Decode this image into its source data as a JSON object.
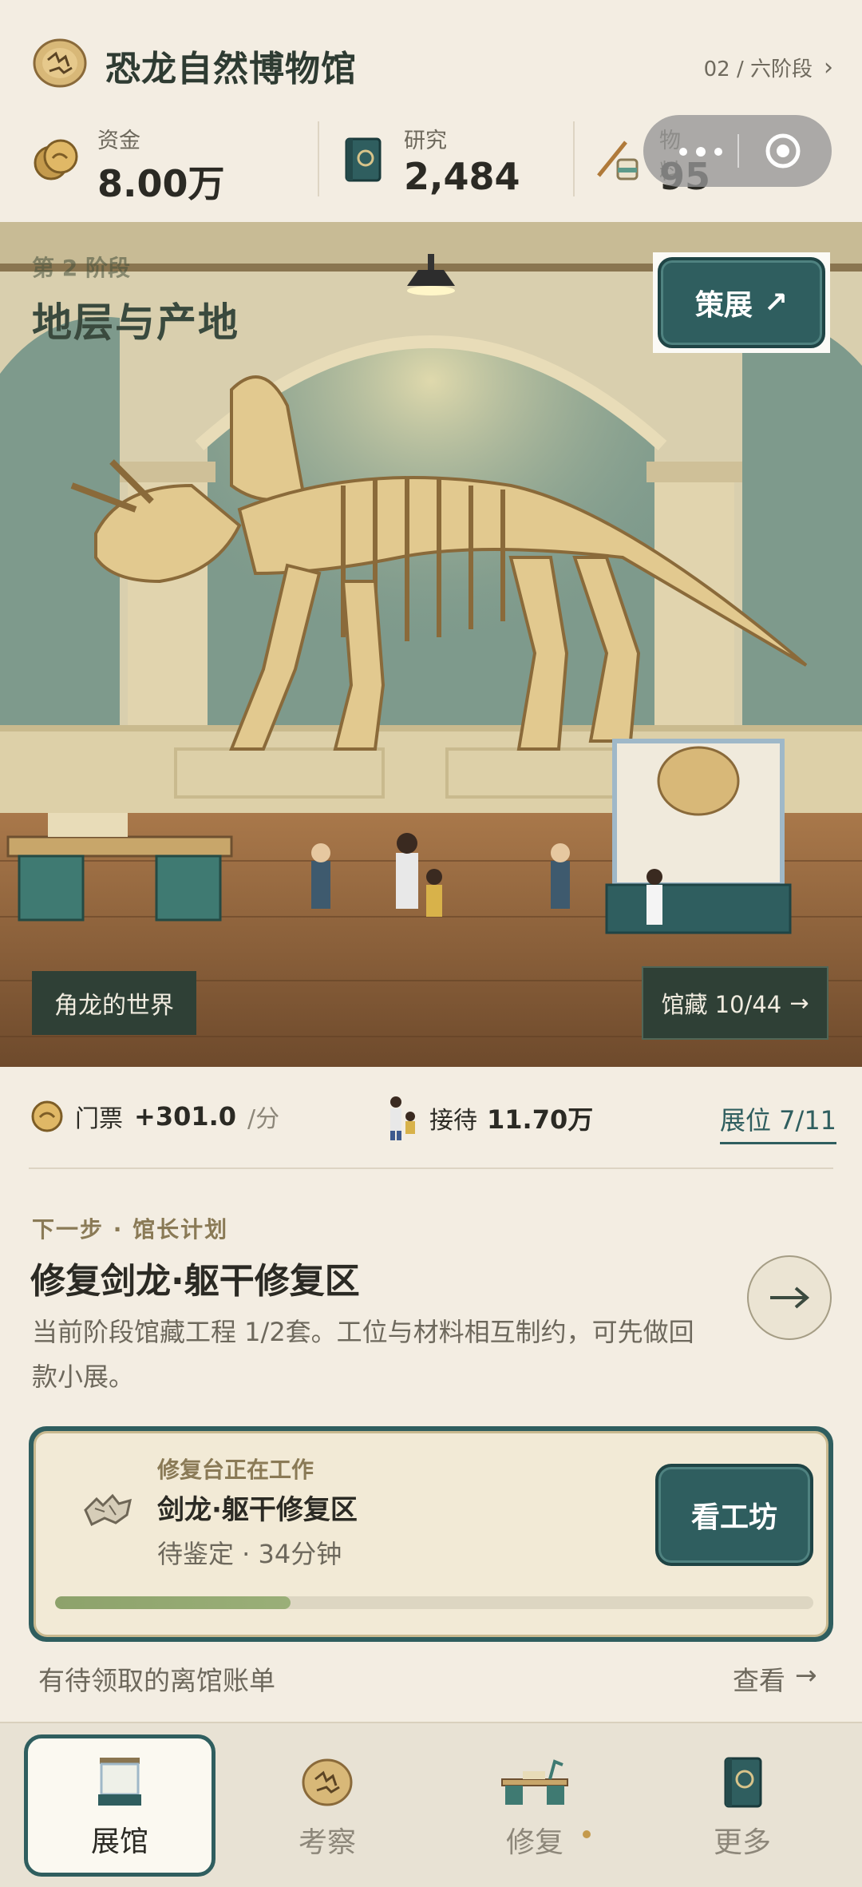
{
  "header": {
    "title": "恐龙自然博物馆",
    "stage_link": "02 / 六阶段",
    "stage_chevron": "›"
  },
  "resources": {
    "funds": {
      "label": "资金",
      "value": "8.00万"
    },
    "research": {
      "label": "研究",
      "value": "2,484"
    },
    "material": {
      "label": "物料",
      "value": "95"
    }
  },
  "scene": {
    "stage_number": "第 2 阶段",
    "stage_name": "地层与产地",
    "curate_label": "策展",
    "curate_arrow": "↗",
    "exhibit_name": "角龙的世界",
    "collection_label": "馆藏 10/44",
    "collection_arrow": "→"
  },
  "stats": {
    "ticket_label": "门票",
    "ticket_value": "+301.0",
    "ticket_unit": "/分",
    "visit_label": "接待",
    "visit_value": "11.70万",
    "booth_label": "展位 7/11"
  },
  "next_step": {
    "label": "下一步 · 馆长计划",
    "title": "修复剑龙·躯干修复区",
    "description": "当前阶段馆藏工程 1/2套。工位与材料相互制约，可先做回款小展。"
  },
  "workshop": {
    "subtitle": "修复台正在工作",
    "title": "剑龙·躯干修复区",
    "meta": "待鉴定 · 34分钟",
    "button_label": "看工坊",
    "progress": 0.31
  },
  "bill": {
    "text": "有待领取的离馆账单",
    "view_label": "查看",
    "view_arrow": "→"
  },
  "tabs": [
    {
      "label": "展馆",
      "icon": "display-case-icon",
      "active": true
    },
    {
      "label": "考察",
      "icon": "fossil-icon",
      "active": false
    },
    {
      "label": "修复",
      "icon": "workbench-icon",
      "active": false,
      "badge": true
    },
    {
      "label": "更多",
      "icon": "book-icon",
      "active": false
    }
  ],
  "colors": {
    "background": "#f3ede2",
    "accent_teal": "#2f5e5f",
    "dark_green": "#2f4036",
    "progress_green": "#8da26b",
    "gold": "#c49a4c"
  }
}
